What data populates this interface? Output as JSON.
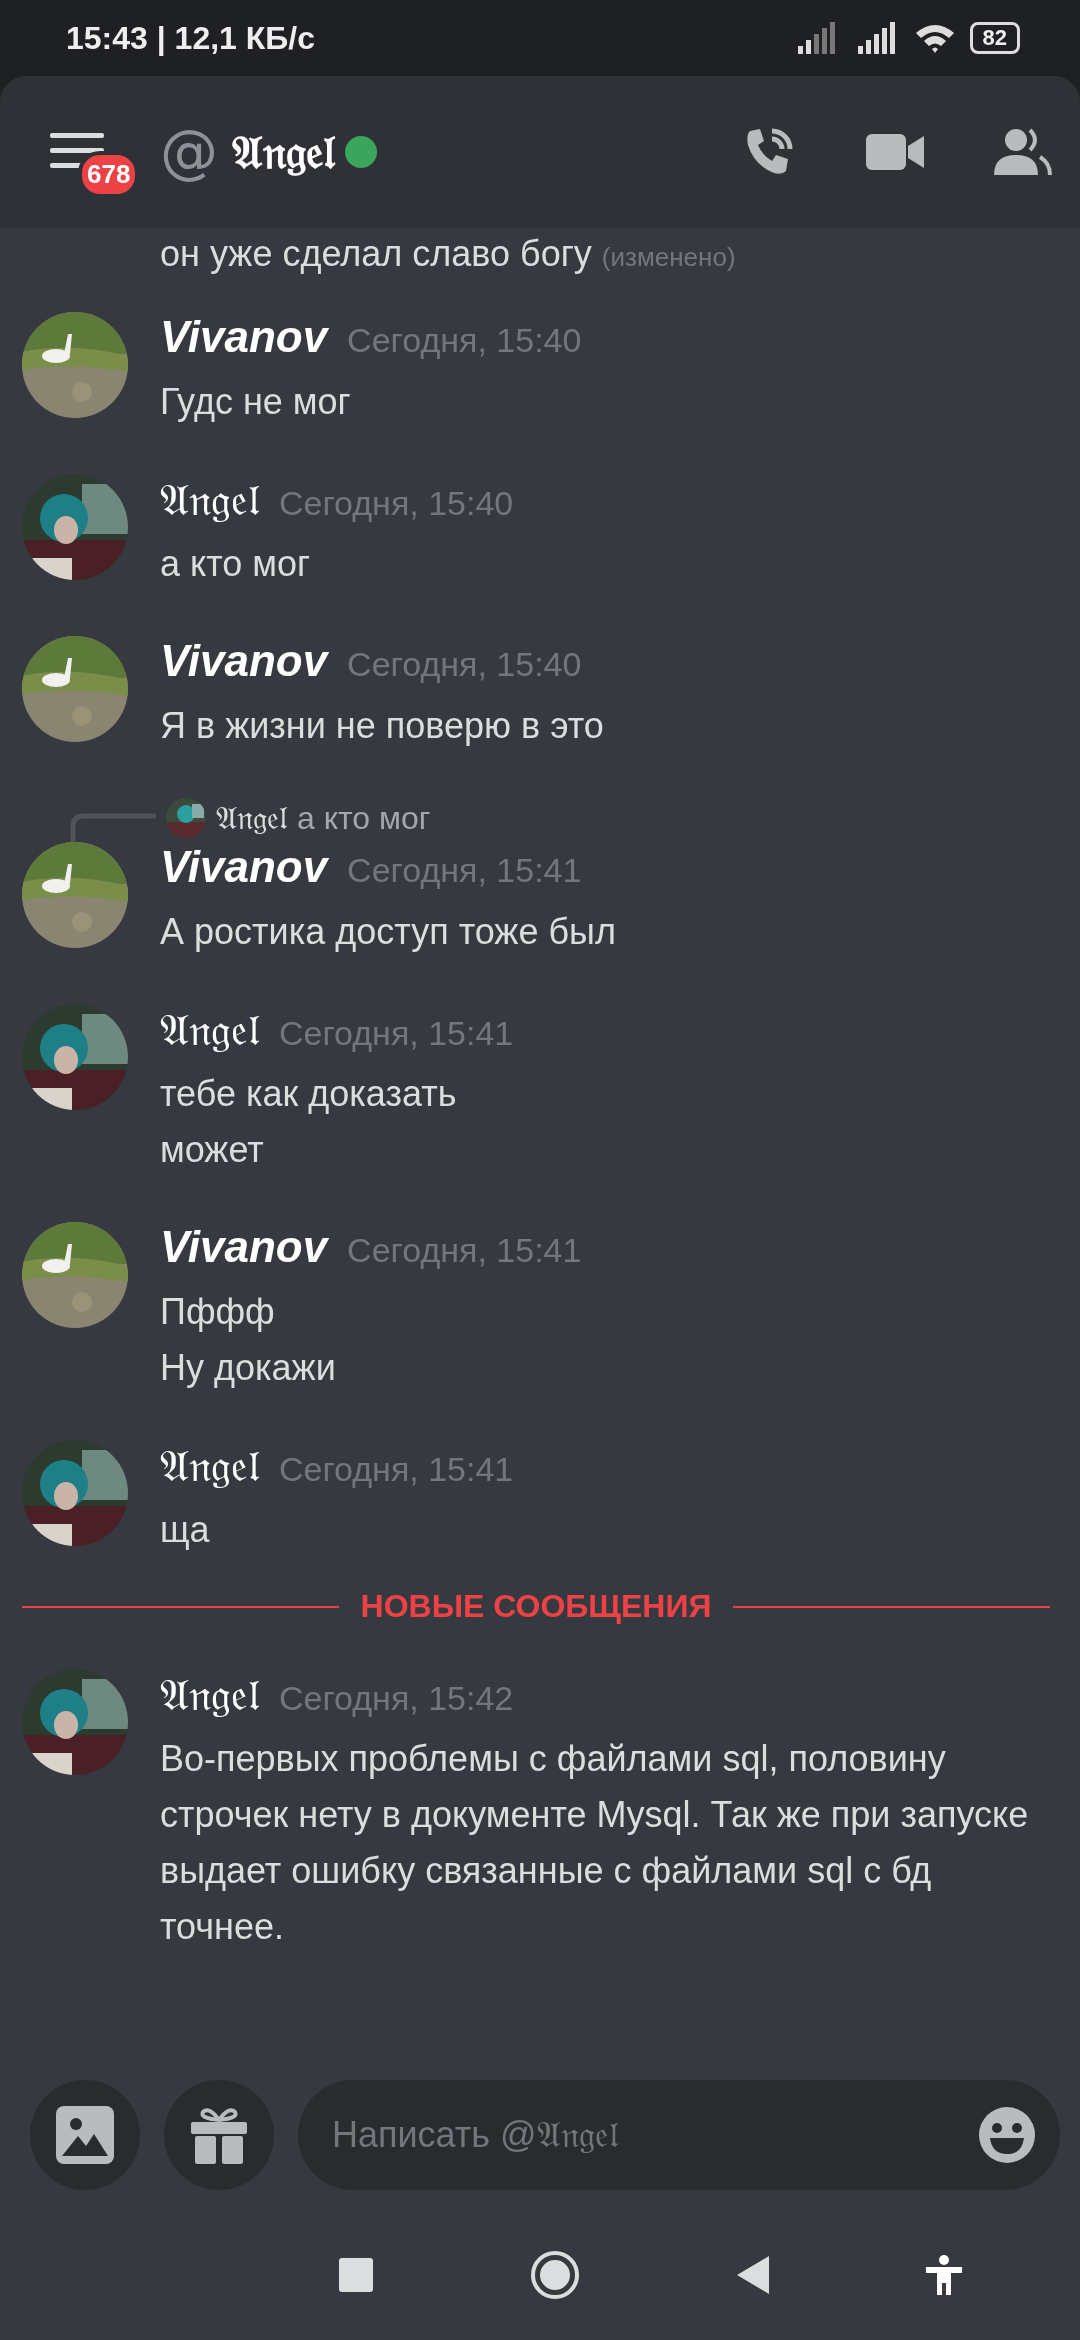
{
  "status_bar": {
    "time": "15:43 | 12,1 КБ/с",
    "battery": "82"
  },
  "header": {
    "badge": "678",
    "at": "@",
    "title": "𝔄𝔫𝔤𝔢𝔩",
    "online": true
  },
  "messages": [
    {
      "kind": "continuation",
      "text": "он уже сделал славо богу",
      "edited": "(изменено)"
    },
    {
      "kind": "group",
      "author": "Vivanov",
      "italic": true,
      "time": "Сегодня, 15:40",
      "lines": [
        "Гудс не мог"
      ]
    },
    {
      "kind": "group",
      "author": "𝔄𝔫𝔤𝔢𝔩",
      "italic": false,
      "time": "Сегодня, 15:40",
      "lines": [
        "а кто мог"
      ]
    },
    {
      "kind": "group",
      "author": "Vivanov",
      "italic": true,
      "time": "Сегодня, 15:40",
      "lines": [
        "Я в жизни не поверю в это"
      ]
    },
    {
      "kind": "group",
      "author": "Vivanov",
      "italic": true,
      "time": "Сегодня, 15:41",
      "lines": [
        "А ростика доступ тоже был"
      ],
      "reply": {
        "author": "𝔄𝔫𝔤𝔢𝔩",
        "text": "а кто мог"
      }
    },
    {
      "kind": "group",
      "author": "𝔄𝔫𝔤𝔢𝔩",
      "italic": false,
      "time": "Сегодня, 15:41",
      "lines": [
        "тебе как доказать",
        "может"
      ]
    },
    {
      "kind": "group",
      "author": "Vivanov",
      "italic": true,
      "time": "Сегодня, 15:41",
      "lines": [
        "Пффф",
        "Ну докажи"
      ]
    },
    {
      "kind": "group",
      "author": "𝔄𝔫𝔤𝔢𝔩",
      "italic": false,
      "time": "Сегодня, 15:41",
      "lines": [
        "ща"
      ]
    },
    {
      "kind": "divider",
      "text": "НОВЫЕ СООБЩЕНИЯ"
    },
    {
      "kind": "group",
      "author": "𝔄𝔫𝔤𝔢𝔩",
      "italic": false,
      "time": "Сегодня, 15:42",
      "lines": [
        "Во-первых проблемы с файлами sql, половину строчек нету в документе Mysql. Так же при запуске выдает ошибку связанные с файлами sql с бд точнее."
      ]
    }
  ],
  "composer": {
    "placeholder": "Написать @𝔄𝔫𝔤𝔢𝔩"
  }
}
